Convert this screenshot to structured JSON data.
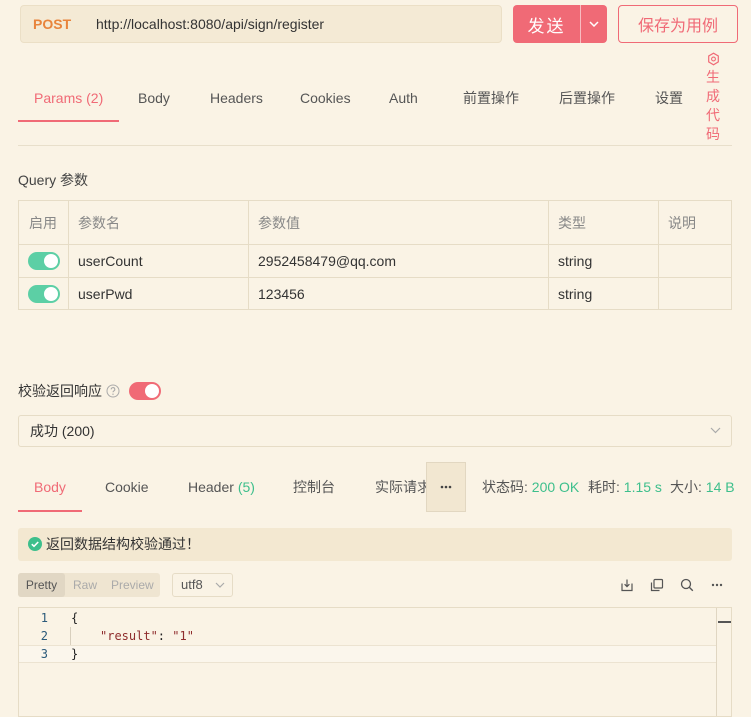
{
  "colors": {
    "accent": "#f06a76",
    "success": "#3dbf8c",
    "toggle_on": "#5ccfa5",
    "method_post": "#e8843c",
    "background": "#faf3e5"
  },
  "request": {
    "method": "POST",
    "url": "http://localhost:8080/api/sign/register",
    "send_label": "发送",
    "send_menu_icon": "chevron-down-icon",
    "save_label": "保存为用例",
    "tabs": [
      {
        "label": "Params",
        "count": "(2)",
        "active": true
      },
      {
        "label": "Body",
        "active": false
      },
      {
        "label": "Headers",
        "active": false
      },
      {
        "label": "Cookies",
        "active": false
      },
      {
        "label": "Auth",
        "active": false
      },
      {
        "label": "前置操作",
        "active": false
      },
      {
        "label": "后置操作",
        "active": false
      },
      {
        "label": "设置",
        "active": false
      }
    ],
    "generate_code": {
      "icon": "code-generate-icon",
      "label": "生成代码"
    }
  },
  "query": {
    "title": "Query 参数",
    "columns": [
      "启用",
      "参数名",
      "参数值",
      "类型",
      "说明"
    ],
    "rows": [
      {
        "enabled": true,
        "name": "userCount",
        "value": "2952458479@qq.com",
        "type": "string",
        "description": ""
      },
      {
        "enabled": true,
        "name": "userPwd",
        "value": "123456",
        "type": "string",
        "description": ""
      }
    ]
  },
  "validation": {
    "label": "校验返回响应",
    "help_icon": "help-icon",
    "enabled": true,
    "selected_response": "成功 (200)"
  },
  "response": {
    "tabs": [
      {
        "label": "Body",
        "active": true
      },
      {
        "label": "Cookie",
        "active": false
      },
      {
        "label": "Header",
        "count": "(5)",
        "active": false
      },
      {
        "label": "控制台",
        "active": false
      },
      {
        "label": "实际请求",
        "active": false
      }
    ],
    "more_icon": "more-horizontal-icon",
    "status": {
      "label": "状态码:",
      "value": "200 OK"
    },
    "time": {
      "label": "耗时:",
      "value": "1.15 s"
    },
    "size": {
      "label": "大小:",
      "value": "14 B"
    },
    "validation_message": "返回数据结构校验通过！",
    "validation_icon": "check-circle-icon",
    "view_modes": [
      {
        "label": "Pretty",
        "active": true
      },
      {
        "label": "Raw",
        "active": false
      },
      {
        "label": "Preview",
        "active": false
      }
    ],
    "encoding": "utf8",
    "toolbar_icons": [
      "download-icon",
      "copy-icon",
      "search-icon",
      "more-horizontal-icon"
    ],
    "code": {
      "lines": [
        {
          "number": "1",
          "text": "{"
        },
        {
          "number": "2",
          "key": "\"result\"",
          "colon": ":",
          "value": "\"1\""
        },
        {
          "number": "3",
          "text": "}"
        }
      ]
    }
  }
}
